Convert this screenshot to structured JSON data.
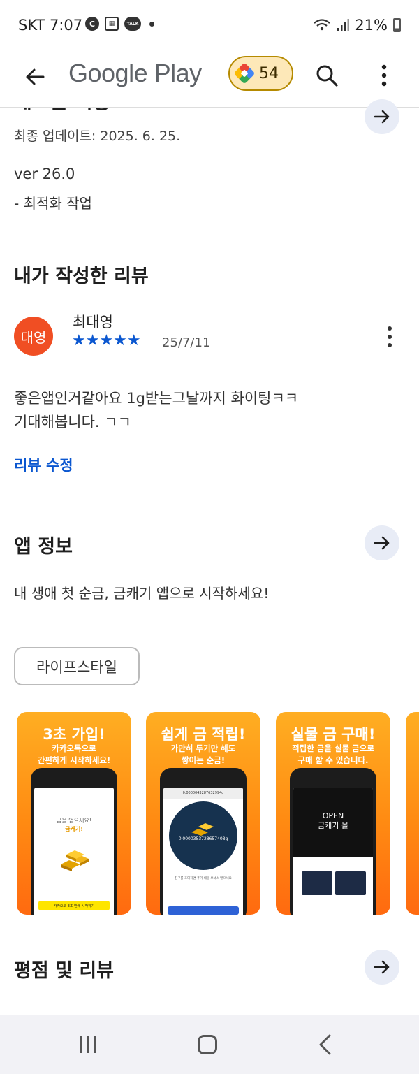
{
  "status_bar": {
    "carrier": "SKT",
    "time": "7:07",
    "icons": [
      "c-icon",
      "calendar-icon",
      "talk-icon",
      "dot-icon"
    ],
    "talk_label": "TALK",
    "battery": "21%"
  },
  "app_bar": {
    "title": "Google Play",
    "points": "54"
  },
  "update_section": {
    "title_peek": "새로운 기능",
    "last_updated": "최종 업데이트: 2025. 6. 25.",
    "version": "ver 26.0",
    "notes": "- 최적화 작업"
  },
  "my_review": {
    "heading": "내가 작성한 리뷰",
    "avatar_text": "대영",
    "avatar_color": "#f04e23",
    "reviewer": "최대영",
    "stars": "★★★★★",
    "rating": 5,
    "date": "25/7/11",
    "text_line1": "좋은앱인거같아요 1g받는그날까지 화이팅ㅋㅋ",
    "text_line2": "기대해봅니다. ㄱㄱ",
    "edit_label": "리뷰 수정"
  },
  "app_info": {
    "heading": "앱 정보",
    "description": "내 생애 첫 순금, 금캐기 앱으로 시작하세요!",
    "category_chip": "라이프스타일"
  },
  "screenshots": [
    {
      "title": "3초 가입!",
      "sub1": "카카오톡으로",
      "sub2": "간편하게 시작하세요!",
      "screen_line1": "금을 얻으세요!",
      "screen_line2": "금캐기!",
      "button": "카카오로 3초 만에 시작하기"
    },
    {
      "title": "쉽게 금 적립!",
      "sub1": "가만히 두기만 해도",
      "sub2": "쌓이는 순금!",
      "top_value": "0.0000043287632994g",
      "amount": "0.0000353728657408g",
      "footer": "친구를 초대하면 추가 채굴 보너스 받으세요"
    },
    {
      "title": "실물 금 구매!",
      "sub1": "적립한 금을 실물 금으로",
      "sub2": "구매 할 수 있습니다.",
      "open_line1": "OPEN",
      "open_line2": "금캐기 몰"
    }
  ],
  "ratings": {
    "heading": "평점 및 리뷰"
  },
  "colors": {
    "accent_blue": "#0b57d0",
    "arrow_bg": "#e8ecf6",
    "points_bg": "#fde8b8"
  }
}
